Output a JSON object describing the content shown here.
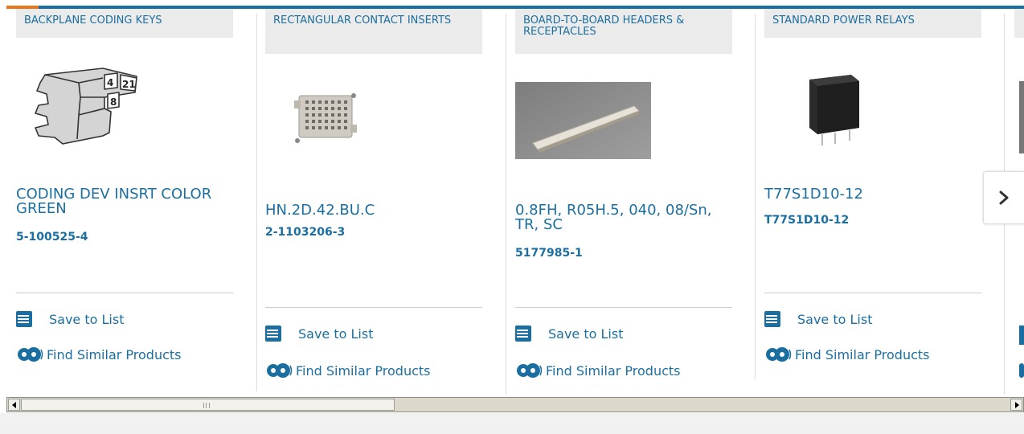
{
  "colors": {
    "accent": "#e8771e",
    "brand_blue": "#1b6fa0",
    "category_bg": "#ebebeb"
  },
  "products": [
    {
      "category": "BACKPLANE CODING KEYS",
      "title": "CODING DEV INSRT COLOR GREEN",
      "part_number": "5-100525-4",
      "save_label": "Save to List",
      "similar_label": "Find Similar Products",
      "image": "coding-key-drawing"
    },
    {
      "category": "RECTANGULAR CONTACT INSERTS",
      "title": "HN.2D.42.BU.C",
      "part_number": "2-1103206-3",
      "save_label": "Save to List",
      "similar_label": "Find Similar Products",
      "image": "contact-insert-photo"
    },
    {
      "category": "BOARD-TO-BOARD HEADERS & RECEPTACLES",
      "title": "0.8FH, R05H.5, 040, 08/Sn, TR, SC",
      "part_number": "5177985-1",
      "save_label": "Save to List",
      "similar_label": "Find Similar Products",
      "image": "header-photo"
    },
    {
      "category": "STANDARD POWER RELAYS",
      "title": "T77S1D10-12",
      "part_number": "T77S1D10-12",
      "save_label": "Save to List",
      "similar_label": "Find Similar Products",
      "image": "relay-photo"
    }
  ],
  "carousel": {
    "next_icon": "chevron-right-icon"
  },
  "scrollbar": {
    "left_icon": "triangle-left-icon",
    "right_icon": "triangle-right-icon"
  }
}
